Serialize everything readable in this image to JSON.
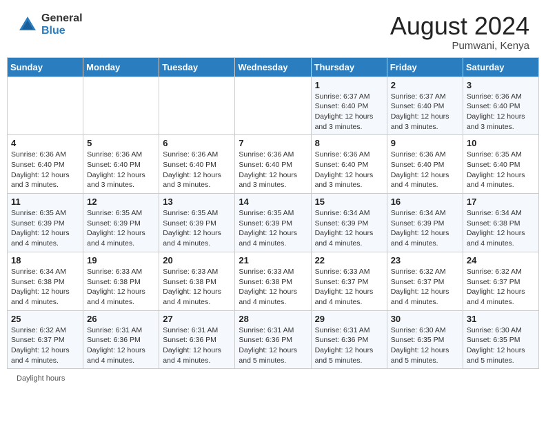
{
  "header": {
    "logo_general": "General",
    "logo_blue": "Blue",
    "month_year": "August 2024",
    "location": "Pumwani, Kenya"
  },
  "days_of_week": [
    "Sunday",
    "Monday",
    "Tuesday",
    "Wednesday",
    "Thursday",
    "Friday",
    "Saturday"
  ],
  "footer": {
    "daylight_hours_label": "Daylight hours"
  },
  "weeks": [
    [
      {
        "day": "",
        "info": ""
      },
      {
        "day": "",
        "info": ""
      },
      {
        "day": "",
        "info": ""
      },
      {
        "day": "",
        "info": ""
      },
      {
        "day": "1",
        "info": "Sunrise: 6:37 AM\nSunset: 6:40 PM\nDaylight: 12 hours and 3 minutes."
      },
      {
        "day": "2",
        "info": "Sunrise: 6:37 AM\nSunset: 6:40 PM\nDaylight: 12 hours and 3 minutes."
      },
      {
        "day": "3",
        "info": "Sunrise: 6:36 AM\nSunset: 6:40 PM\nDaylight: 12 hours and 3 minutes."
      }
    ],
    [
      {
        "day": "4",
        "info": "Sunrise: 6:36 AM\nSunset: 6:40 PM\nDaylight: 12 hours and 3 minutes."
      },
      {
        "day": "5",
        "info": "Sunrise: 6:36 AM\nSunset: 6:40 PM\nDaylight: 12 hours and 3 minutes."
      },
      {
        "day": "6",
        "info": "Sunrise: 6:36 AM\nSunset: 6:40 PM\nDaylight: 12 hours and 3 minutes."
      },
      {
        "day": "7",
        "info": "Sunrise: 6:36 AM\nSunset: 6:40 PM\nDaylight: 12 hours and 3 minutes."
      },
      {
        "day": "8",
        "info": "Sunrise: 6:36 AM\nSunset: 6:40 PM\nDaylight: 12 hours and 3 minutes."
      },
      {
        "day": "9",
        "info": "Sunrise: 6:36 AM\nSunset: 6:40 PM\nDaylight: 12 hours and 4 minutes."
      },
      {
        "day": "10",
        "info": "Sunrise: 6:35 AM\nSunset: 6:40 PM\nDaylight: 12 hours and 4 minutes."
      }
    ],
    [
      {
        "day": "11",
        "info": "Sunrise: 6:35 AM\nSunset: 6:39 PM\nDaylight: 12 hours and 4 minutes."
      },
      {
        "day": "12",
        "info": "Sunrise: 6:35 AM\nSunset: 6:39 PM\nDaylight: 12 hours and 4 minutes."
      },
      {
        "day": "13",
        "info": "Sunrise: 6:35 AM\nSunset: 6:39 PM\nDaylight: 12 hours and 4 minutes."
      },
      {
        "day": "14",
        "info": "Sunrise: 6:35 AM\nSunset: 6:39 PM\nDaylight: 12 hours and 4 minutes."
      },
      {
        "day": "15",
        "info": "Sunrise: 6:34 AM\nSunset: 6:39 PM\nDaylight: 12 hours and 4 minutes."
      },
      {
        "day": "16",
        "info": "Sunrise: 6:34 AM\nSunset: 6:39 PM\nDaylight: 12 hours and 4 minutes."
      },
      {
        "day": "17",
        "info": "Sunrise: 6:34 AM\nSunset: 6:38 PM\nDaylight: 12 hours and 4 minutes."
      }
    ],
    [
      {
        "day": "18",
        "info": "Sunrise: 6:34 AM\nSunset: 6:38 PM\nDaylight: 12 hours and 4 minutes."
      },
      {
        "day": "19",
        "info": "Sunrise: 6:33 AM\nSunset: 6:38 PM\nDaylight: 12 hours and 4 minutes."
      },
      {
        "day": "20",
        "info": "Sunrise: 6:33 AM\nSunset: 6:38 PM\nDaylight: 12 hours and 4 minutes."
      },
      {
        "day": "21",
        "info": "Sunrise: 6:33 AM\nSunset: 6:38 PM\nDaylight: 12 hours and 4 minutes."
      },
      {
        "day": "22",
        "info": "Sunrise: 6:33 AM\nSunset: 6:37 PM\nDaylight: 12 hours and 4 minutes."
      },
      {
        "day": "23",
        "info": "Sunrise: 6:32 AM\nSunset: 6:37 PM\nDaylight: 12 hours and 4 minutes."
      },
      {
        "day": "24",
        "info": "Sunrise: 6:32 AM\nSunset: 6:37 PM\nDaylight: 12 hours and 4 minutes."
      }
    ],
    [
      {
        "day": "25",
        "info": "Sunrise: 6:32 AM\nSunset: 6:37 PM\nDaylight: 12 hours and 4 minutes."
      },
      {
        "day": "26",
        "info": "Sunrise: 6:31 AM\nSunset: 6:36 PM\nDaylight: 12 hours and 4 minutes."
      },
      {
        "day": "27",
        "info": "Sunrise: 6:31 AM\nSunset: 6:36 PM\nDaylight: 12 hours and 4 minutes."
      },
      {
        "day": "28",
        "info": "Sunrise: 6:31 AM\nSunset: 6:36 PM\nDaylight: 12 hours and 5 minutes."
      },
      {
        "day": "29",
        "info": "Sunrise: 6:31 AM\nSunset: 6:36 PM\nDaylight: 12 hours and 5 minutes."
      },
      {
        "day": "30",
        "info": "Sunrise: 6:30 AM\nSunset: 6:35 PM\nDaylight: 12 hours and 5 minutes."
      },
      {
        "day": "31",
        "info": "Sunrise: 6:30 AM\nSunset: 6:35 PM\nDaylight: 12 hours and 5 minutes."
      }
    ]
  ]
}
